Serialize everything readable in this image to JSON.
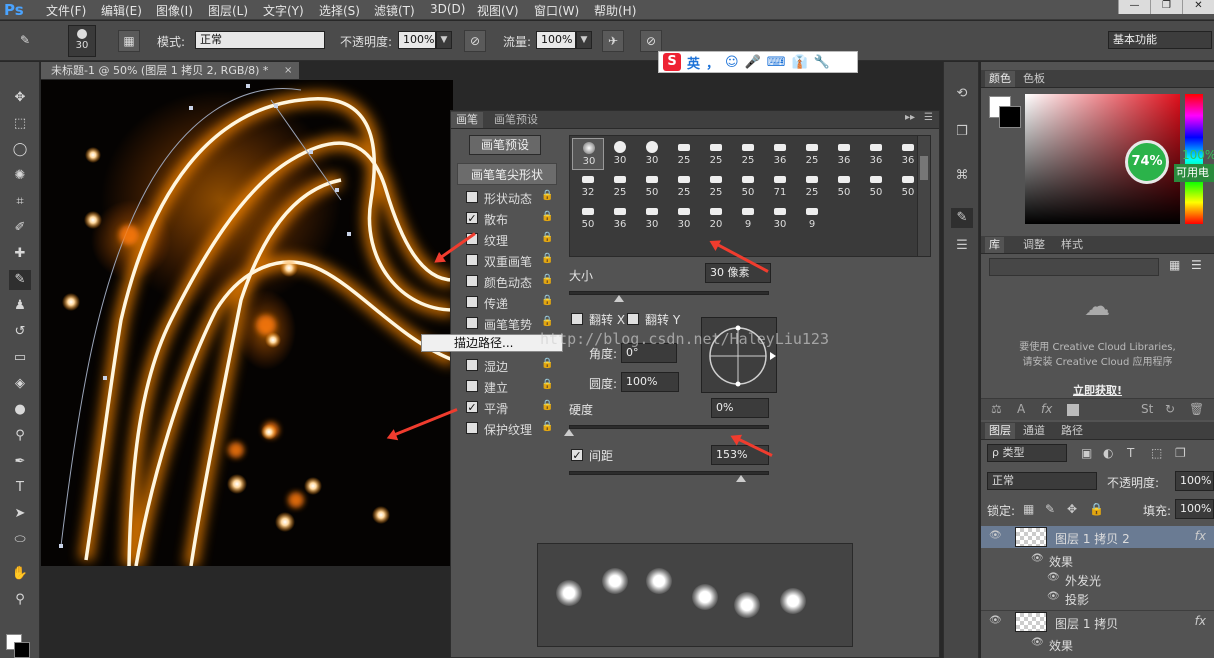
{
  "app": {
    "logo": "Ps"
  },
  "menu": [
    "文件(F)",
    "编辑(E)",
    "图像(I)",
    "图层(L)",
    "文字(Y)",
    "选择(S)",
    "滤镜(T)",
    "3D(D)",
    "视图(V)",
    "窗口(W)",
    "帮助(H)"
  ],
  "window_controls": {
    "minimize": "—",
    "restore": "❐",
    "close": "✕"
  },
  "options": {
    "brush_size": "30",
    "mode_label": "模式:",
    "mode_value": "正常",
    "opacity_label": "不透明度:",
    "opacity_value": "100%",
    "flow_label": "流量:",
    "flow_value": "100%",
    "workspace": "基本功能"
  },
  "document": {
    "tab_title": "未标题-1 @ 50% (图层 1 拷贝 2, RGB/8) *",
    "tab_close": "×"
  },
  "ime": {
    "logo": "S",
    "lang": "英",
    "punct": "，",
    "items": [
      "☺",
      "🎤",
      "⌨",
      "👔",
      "🔧"
    ]
  },
  "brush_panel": {
    "tabs": [
      "画笔",
      "画笔预设"
    ],
    "preset_button": "画笔预设",
    "tip_shape_header": "画笔笔尖形状",
    "options": [
      {
        "label": "形状动态",
        "checked": false
      },
      {
        "label": "散布",
        "checked": true
      },
      {
        "label": "纹理",
        "checked": false
      },
      {
        "label": "双重画笔",
        "checked": false
      },
      {
        "label": "颜色动态",
        "checked": false
      },
      {
        "label": "传递",
        "checked": false
      },
      {
        "label": "画笔笔势",
        "checked": false
      },
      {
        "label": "杂色",
        "checked": false
      },
      {
        "label": "湿边",
        "checked": false
      },
      {
        "label": "建立",
        "checked": false
      },
      {
        "label": "平滑",
        "checked": true
      },
      {
        "label": "保护纹理",
        "checked": false
      }
    ],
    "tip_sizes": [
      "30",
      "30",
      "30",
      "25",
      "25",
      "25",
      "36",
      "25",
      "36",
      "36",
      "36",
      "32",
      "25",
      "50",
      "25",
      "25",
      "50",
      "71",
      "25",
      "50",
      "50",
      "50",
      "50",
      "36",
      "30",
      "30",
      "20",
      "9",
      "30",
      "9"
    ],
    "size_label": "大小",
    "size_value": "30 像素",
    "flip_x": "翻转 X",
    "flip_y": "翻转 Y",
    "angle_label": "角度:",
    "angle_value": "0°",
    "roundness_label": "圆度:",
    "roundness_value": "100%",
    "hardness_label": "硬度",
    "hardness_value": "0%",
    "spacing_label": "间距",
    "spacing_value": "153%",
    "size_level": 0.25,
    "hardness_level": 0.0,
    "spacing_level": 0.86
  },
  "context_menu": {
    "item": "描边路径..."
  },
  "watermark": "http://blog.csdn.net/HaleyLiu123",
  "right_panel": {
    "color_tabs": [
      "颜色",
      "色板"
    ],
    "battery": {
      "percent": "74%",
      "label_pct": "100%",
      "label_text": "可用电量"
    },
    "lib_tabs": [
      "库",
      "调整",
      "样式"
    ],
    "lib_msg1": "要使用 Creative Cloud Libraries,",
    "lib_msg2": "请安装 Creative Cloud 应用程序",
    "lib_link": "立即获取!",
    "layer_tabs": [
      "图层",
      "通道",
      "路径"
    ],
    "filter_label": "ρ 类型",
    "blend_mode": "正常",
    "opacity_label": "不透明度:",
    "opacity_value": "100%",
    "lock_label": "锁定:",
    "fill_label": "填充:",
    "fill_value": "100%",
    "layers": [
      {
        "name": "图层 1 拷贝 2",
        "fx": "fx",
        "effects_label": "效果",
        "effects": [
          "外发光",
          "投影"
        ]
      },
      {
        "name": "图层 1 拷贝",
        "fx": "fx",
        "effects_label": "效果"
      }
    ]
  },
  "colors": {
    "accent": "#4aa3ff",
    "arrow": "#f03c2e",
    "battery": "#2bb34a"
  }
}
